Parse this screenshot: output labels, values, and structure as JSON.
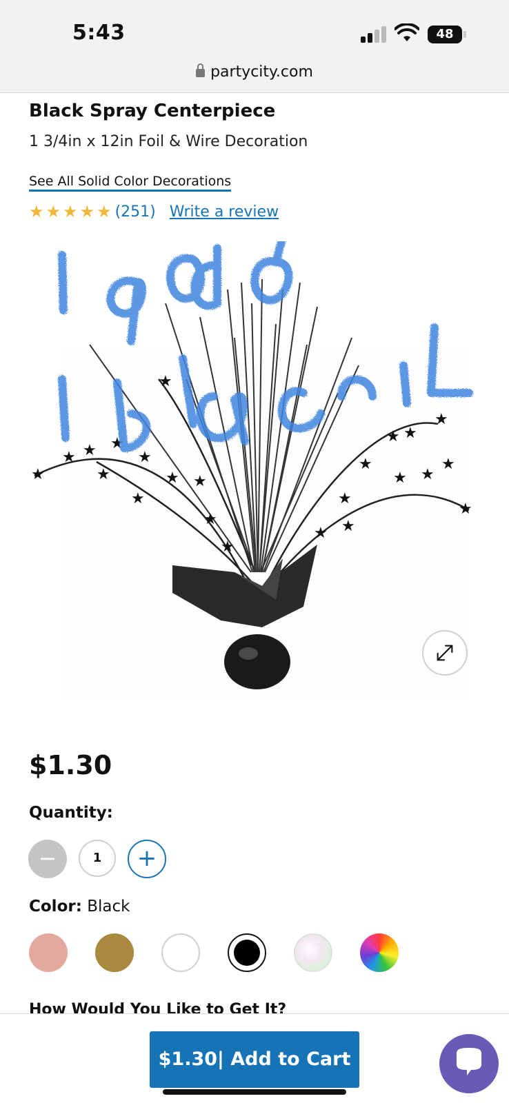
{
  "status_bar": {
    "time": "5:43",
    "battery": "48",
    "battery_level": 0.48
  },
  "browser": {
    "url": "partycity.com"
  },
  "product": {
    "title": "Black Spray Centerpiece",
    "subtitle": "1 3/4in x 12in Foil & Wire Decoration",
    "see_all_link": "See All Solid Color Decorations",
    "rating": {
      "stars": 5,
      "star_glyph": "★",
      "count": "(251)",
      "write_review": "Write a review"
    },
    "image": {
      "description_icon": "centerpiece-image",
      "annotation_color": "#3f86e0"
    },
    "price": "$1.30"
  },
  "quantity": {
    "label": "Quantity:",
    "value": "1",
    "minus_glyph": "−",
    "plus_glyph": "+"
  },
  "color": {
    "label": "Color:",
    "selected": "Black",
    "swatches": [
      {
        "name": "rose-gold",
        "color": "#e3a99e",
        "selected": false
      },
      {
        "name": "gold",
        "color": "#a8893d",
        "selected": false
      },
      {
        "name": "white",
        "color": "#ffffff",
        "selected": false
      },
      {
        "name": "black",
        "color": "#000000",
        "selected": true
      },
      {
        "name": "iridescent",
        "color": "#e6f3dd",
        "selected": false
      },
      {
        "name": "multicolor",
        "color": "#ff4a4a",
        "selected": false
      }
    ]
  },
  "fulfillment": {
    "heading": "How Would You Like to Get It?"
  },
  "cart": {
    "button_label": "$1.30| Add to Cart"
  },
  "colors": {
    "accent": "#1673b5",
    "star": "#f2b63b",
    "chat": "#6a5ab5"
  }
}
